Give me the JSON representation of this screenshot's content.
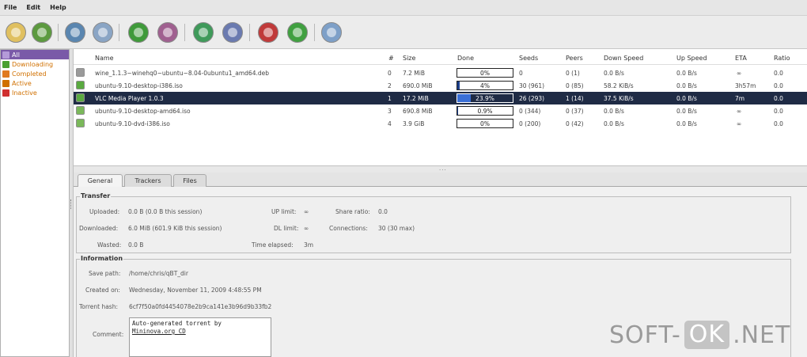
{
  "menu": {
    "file": "File",
    "edit": "Edit",
    "help": "Help"
  },
  "toolbar": {
    "buttons": [
      {
        "icon": "open-icon",
        "color": "#e0c060"
      },
      {
        "icon": "open-url-icon",
        "color": "#5c9a3f"
      },
      {
        "icon": "delete-icon",
        "color": "#5a86b0"
      },
      {
        "icon": "delete-permanently-icon",
        "color": "#8aa5c5"
      },
      {
        "icon": "start-icon",
        "color": "#3f9a3a"
      },
      {
        "icon": "pause-icon",
        "color": "#a06090"
      },
      {
        "icon": "start-all-icon",
        "color": "#3f9a5a"
      },
      {
        "icon": "pause-all-icon",
        "color": "#6a7ab0"
      },
      {
        "icon": "decrease-priority-icon",
        "color": "#c03a3a"
      },
      {
        "icon": "increase-priority-icon",
        "color": "#40a040"
      },
      {
        "icon": "options-icon",
        "color": "#7ea0c8"
      }
    ]
  },
  "sidebar": {
    "items": [
      {
        "label": "All",
        "color": "#7a5aa8"
      },
      {
        "label": "Downloading",
        "color": "#4aa030"
      },
      {
        "label": "Completed",
        "color": "#e07a20"
      },
      {
        "label": "Active",
        "color": "#d07000"
      },
      {
        "label": "Inactive",
        "color": "#d03030"
      }
    ]
  },
  "table": {
    "columns": [
      "Name",
      "#",
      "Size",
      "Done",
      "Seeds",
      "Peers",
      "Down Speed",
      "Up Speed",
      "ETA",
      "Ratio"
    ],
    "rows": [
      {
        "name": "wine_1.1.3~winehq0~ubuntu~8.04-0ubuntu1_amd64.deb",
        "num": "0",
        "size": "7.2 MiB",
        "progress": 0,
        "done": "0%",
        "seeds": "0",
        "peers": "0 (1)",
        "down": "0.0 B/s",
        "up": "0.0 B/s",
        "eta": "∞",
        "ratio": "0.0"
      },
      {
        "name": "ubuntu-9.10-desktop-i386.iso",
        "num": "2",
        "size": "690.0 MiB",
        "progress": 0.04,
        "done": "4%",
        "seeds": "30 (961)",
        "peers": "0 (85)",
        "down": "58.2 KiB/s",
        "up": "0.0 B/s",
        "eta": "3h57m",
        "ratio": "0.0"
      },
      {
        "name": "VLC Media Player 1.0.3",
        "num": "1",
        "size": "17.2 MiB",
        "progress": 0.239,
        "done": "23.9%",
        "seeds": "26 (293)",
        "peers": "1 (14)",
        "down": "37.5 KiB/s",
        "up": "0.0 B/s",
        "eta": "7m",
        "ratio": "0.0"
      },
      {
        "name": "ubuntu-9.10-desktop-amd64.iso",
        "num": "3",
        "size": "690.8 MiB",
        "progress": 0.009,
        "done": "0.9%",
        "seeds": "0 (344)",
        "peers": "0 (37)",
        "down": "0.0 B/s",
        "up": "0.0 B/s",
        "eta": "∞",
        "ratio": "0.0"
      },
      {
        "name": "ubuntu-9.10-dvd-i386.iso",
        "num": "4",
        "size": "3.9 GiB",
        "progress": 0,
        "done": "0%",
        "seeds": "0 (200)",
        "peers": "0 (42)",
        "down": "0.0 B/s",
        "up": "0.0 B/s",
        "eta": "∞",
        "ratio": "0.0"
      }
    ]
  },
  "tabs": [
    "General",
    "Trackers",
    "Files"
  ],
  "transfer": {
    "title": "Transfer",
    "uploaded_label": "Uploaded:",
    "uploaded_value": "0.0 B (0.0 B this session)",
    "downloaded_label": "Downloaded:",
    "downloaded_value": "6.0 MiB (601.9 KiB this session)",
    "wasted_label": "Wasted:",
    "wasted_value": "0.0 B",
    "up_limit_label": "UP limit:",
    "up_limit_value": "∞",
    "dl_limit_label": "DL limit:",
    "dl_limit_value": "∞",
    "time_elapsed_label": "Time elapsed:",
    "time_elapsed_value": "3m",
    "share_ratio_label": "Share ratio:",
    "share_ratio_value": "0.0",
    "connections_label": "Connections:",
    "connections_value": "30 (30 max)"
  },
  "information": {
    "title": "Information",
    "save_path_label": "Save path:",
    "save_path_value": "/home/chris/qBT_dir",
    "created_on_label": "Created on:",
    "created_on_value": "Wednesday, November 11, 2009 4:48:55 PM",
    "torrent_hash_label": "Torrent hash:",
    "torrent_hash_value": "6cf7f50a0fd4454078e2b9ca141e3b96d9b33fb2",
    "comment_label": "Comment:",
    "comment_line1": "Auto-generated torrent by",
    "comment_line2": "Mininova.org CD"
  },
  "watermark": {
    "prefix": "SOFT-",
    "ok": "OK",
    "suffix": ".NET"
  }
}
